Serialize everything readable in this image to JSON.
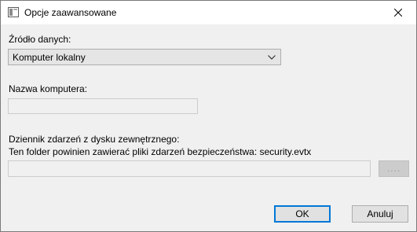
{
  "window": {
    "title": "Opcje zaawansowane",
    "close_label": "Zamknij"
  },
  "source": {
    "label": "Źródło danych:",
    "selected": "Komputer lokalny"
  },
  "computer": {
    "label": "Nazwa komputera:",
    "value": ""
  },
  "external_log": {
    "label": "Dziennik zdarzeń z dysku zewnętrznego:",
    "hint": "Ten folder powinien zawierać pliki zdarzeń bezpieczeństwa: security.evtx",
    "path": "",
    "browse_label": "...."
  },
  "buttons": {
    "ok": "OK",
    "cancel": "Anuluj"
  },
  "colors": {
    "accent": "#0078d7",
    "disabled_text": "#9c9c9c"
  }
}
